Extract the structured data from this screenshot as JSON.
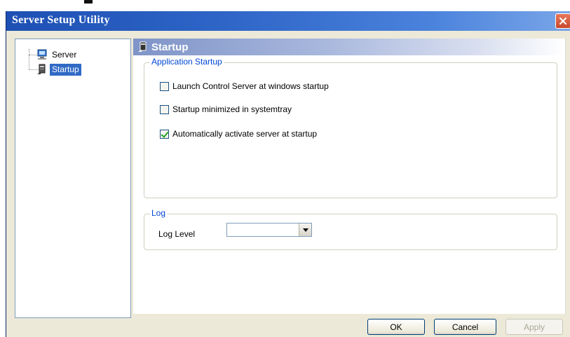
{
  "window": {
    "title": "Server Setup Utility"
  },
  "tree": {
    "items": [
      {
        "label": "Server",
        "icon": "computer-icon",
        "selected": false
      },
      {
        "label": "Startup",
        "icon": "startup-icon",
        "selected": true
      }
    ]
  },
  "panel": {
    "title": "Startup",
    "application_startup": {
      "legend": "Application Startup",
      "options": [
        {
          "label": "Launch Control Server at windows startup",
          "checked": false
        },
        {
          "label": "Startup minimized in systemtray",
          "checked": false
        },
        {
          "label": "Automatically activate server at startup",
          "checked": true
        }
      ]
    },
    "log": {
      "legend": "Log",
      "level_label": "Log Level",
      "level_value": ""
    }
  },
  "buttons": {
    "ok": "OK",
    "cancel": "Cancel",
    "apply": "Apply"
  },
  "colors": {
    "title_bar": "#2f66c8",
    "selection": "#316ac5",
    "group_legend": "#0046d5",
    "close_button": "#d9583a"
  }
}
